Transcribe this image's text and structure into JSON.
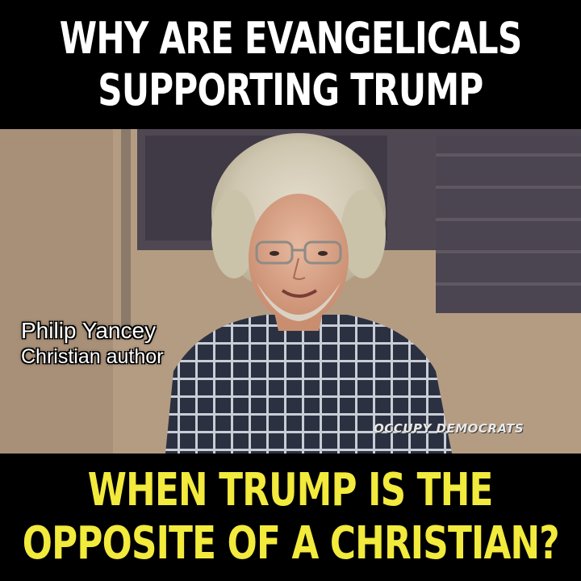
{
  "headline_top": {
    "line1": "WHY ARE EVANGELICALS",
    "line2": "SUPPORTING TRUMP"
  },
  "caption": {
    "name": "Philip Yancey",
    "title": "Christian author"
  },
  "watermark": "OCCUPY DEMOCRATS",
  "headline_bottom": {
    "line1": "WHEN TRUMP IS THE",
    "line2": "OPPOSITE OF A CHRISTIAN?"
  },
  "colors": {
    "band_background": "#000000",
    "top_text": "#ffffff",
    "bottom_text": "#f2ea3c"
  }
}
